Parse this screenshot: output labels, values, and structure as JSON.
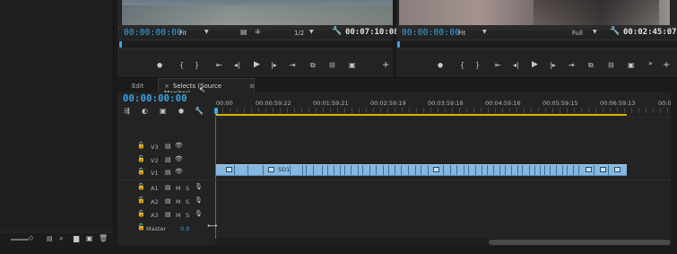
{
  "source_monitor": {
    "timecode_in": "00:00:00:00",
    "zoom": "Fit",
    "resolution": "1/2",
    "duration": "00:07:10:08"
  },
  "program_monitor": {
    "timecode_in": "00:00:00:00",
    "zoom": "Fit",
    "resolution": "Full",
    "duration": "00:02:45:07"
  },
  "timeline": {
    "tabs": [
      {
        "label": "Edit"
      },
      {
        "label": "Selects (Source Monitor)"
      }
    ],
    "timecode": "00:00:00:00",
    "ruler": [
      "00:00",
      "00:00:59:22",
      "00:01:59:21",
      "00:02:59:19",
      "00:03:59:18",
      "00:04:59:16",
      "00:05:59:15",
      "00:06:59:13",
      "00:07"
    ],
    "tracks_video": [
      "V3",
      "V2",
      "V1"
    ],
    "tracks_audio": [
      "A1",
      "A2",
      "A3"
    ],
    "master": {
      "label": "Master",
      "value": "0.0"
    },
    "clip_name": "SD1"
  },
  "colors": {
    "accent": "#3aa4e8",
    "clip": "#86b7de",
    "playhead": "#d63a3a",
    "work_area": "#d9b300"
  }
}
